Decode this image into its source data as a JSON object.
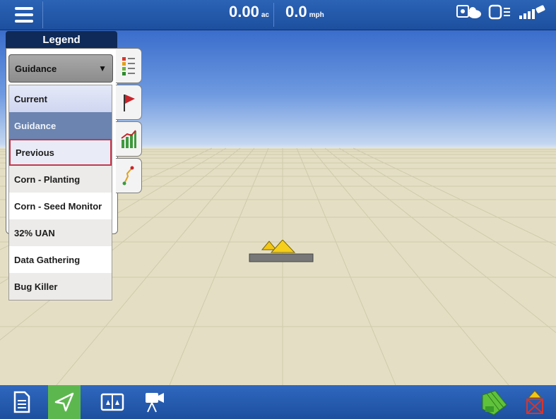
{
  "top_bar": {
    "area_value": "0.00",
    "area_unit": "ac",
    "speed_value": "0.0",
    "speed_unit": "mph",
    "status_icons": [
      "display-link-icon",
      "remote-storage-icon",
      "gps-signal-icon"
    ]
  },
  "legend": {
    "title": "Legend",
    "selected_value": "Guidance",
    "options": [
      {
        "label": "Current",
        "state": "normal"
      },
      {
        "label": "Guidance",
        "state": "selected"
      },
      {
        "label": "Previous",
        "state": "highlighted"
      },
      {
        "label": "Corn - Planting",
        "state": "normal"
      },
      {
        "label": "Corn - Seed Monitor",
        "state": "normal"
      },
      {
        "label": "32% UAN",
        "state": "normal"
      },
      {
        "label": "Data Gathering",
        "state": "normal"
      },
      {
        "label": "Bug Killer",
        "state": "normal"
      }
    ],
    "tabs": [
      "legend-tab-icon",
      "flag-icon",
      "chart-icon",
      "guidance-line-icon"
    ]
  },
  "bottom_bar": {
    "buttons": [
      "document-icon",
      "navigate-icon",
      "split-screen-icon",
      "camera-icon"
    ],
    "active_button": "navigate-icon",
    "right_icons": [
      "coverage-icon",
      "implement-off-icon"
    ]
  },
  "colors": {
    "bar_blue": "#1d4f9e",
    "active_green": "#5cb84e",
    "selected_row": "#6b84b0",
    "highlight_border": "#c23a4e",
    "ground": "#e4dfc4"
  }
}
